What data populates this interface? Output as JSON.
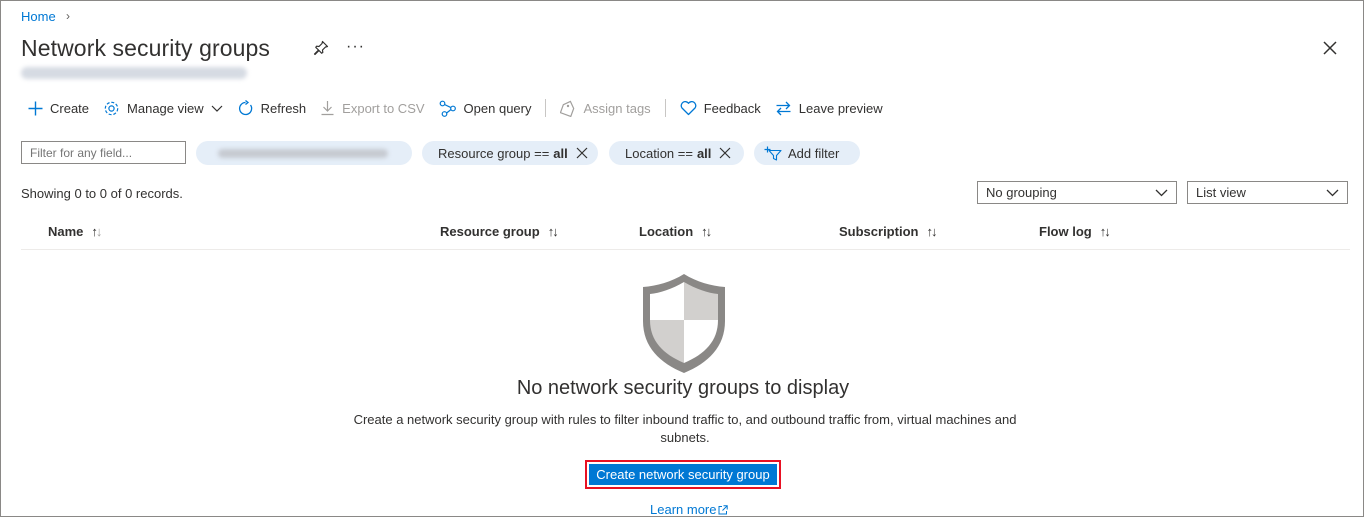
{
  "breadcrumb": {
    "home": "Home",
    "chevron": "›"
  },
  "page": {
    "title": "Network security groups",
    "more": "···"
  },
  "toolbar": {
    "create": "Create",
    "manage_view": "Manage view",
    "refresh": "Refresh",
    "export_csv": "Export to CSV",
    "open_query": "Open query",
    "assign_tags": "Assign tags",
    "feedback": "Feedback",
    "leave_preview": "Leave preview"
  },
  "filters": {
    "search_placeholder": "Filter for any field...",
    "resource_group": {
      "label": "Resource group ==",
      "value": "all"
    },
    "location": {
      "label": "Location ==",
      "value": "all"
    },
    "add_filter": "Add filter"
  },
  "records": {
    "showing": "Showing 0 to 0 of 0 records."
  },
  "view": {
    "grouping": "No grouping",
    "layout": "List view"
  },
  "columns": [
    {
      "label": "Name"
    },
    {
      "label": "Resource group"
    },
    {
      "label": "Location"
    },
    {
      "label": "Subscription"
    },
    {
      "label": "Flow log"
    }
  ],
  "empty_state": {
    "icon": "shield-icon",
    "title": "No network security groups to display",
    "description": "Create a network security group with rules to filter inbound traffic to, and outbound traffic from, virtual machines and subnets.",
    "button": "Create network security group",
    "learn_more": "Learn more"
  },
  "colors": {
    "accent": "#0078d4",
    "highlight_border": "#e81123",
    "pill_bg": "#e5eef8"
  }
}
